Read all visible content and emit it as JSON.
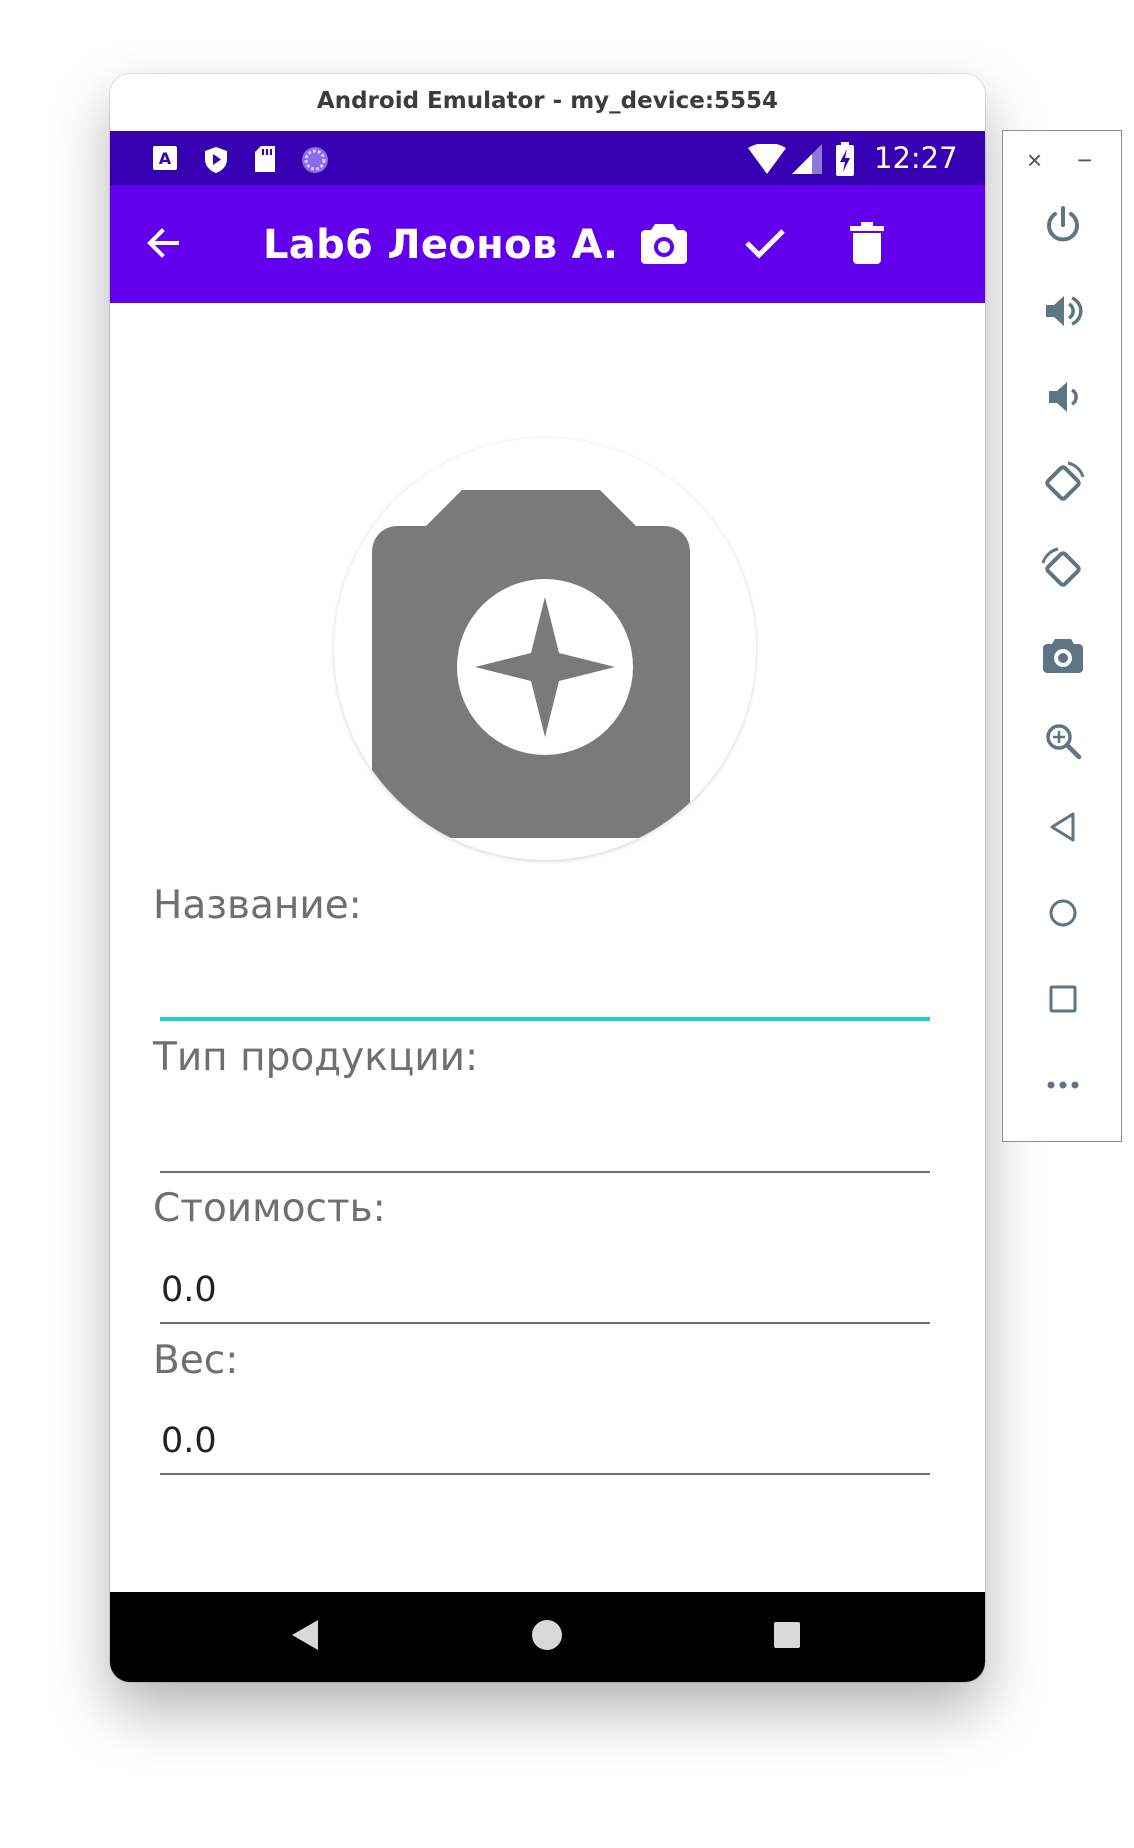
{
  "window": {
    "title": "Android Emulator - my_device:5554"
  },
  "status_bar": {
    "time": "12:27",
    "left_icons": [
      "a-notification-icon",
      "shield-play-icon",
      "sd-card-icon",
      "sync-circle-icon"
    ],
    "right_icons": [
      "wifi-icon",
      "signal-icon",
      "battery-charging-icon"
    ]
  },
  "app_bar": {
    "title": "Lab6 Леонов А.",
    "background": "#6200ee",
    "status_background": "#3700b3",
    "actions": [
      "back-arrow-icon",
      "camera-icon",
      "check-icon",
      "delete-icon"
    ]
  },
  "form": {
    "photo_placeholder_icon": "camera-placeholder-icon",
    "name_label": "Название:",
    "name_value": "",
    "type_label": "Тип продукции:",
    "type_value": "",
    "cost_label": "Стоимость:",
    "cost_value": "0.0",
    "weight_label": "Вес:",
    "weight_value": "0.0",
    "focus_color": "#1fcfc2"
  },
  "nav_bar": {
    "buttons": [
      "nav-back-icon",
      "nav-home-icon",
      "nav-recents-icon"
    ]
  },
  "side_toolbar": {
    "close_glyph": "×",
    "minimize_glyph": "−",
    "buttons": [
      "power-icon",
      "volume-up-icon",
      "volume-down-icon",
      "rotate-left-icon",
      "rotate-right-icon",
      "screenshot-camera-icon",
      "zoom-in-icon",
      "back-triangle-icon",
      "home-circle-icon",
      "overview-square-icon",
      "more-icon"
    ],
    "icon_color": "#5e7583"
  }
}
